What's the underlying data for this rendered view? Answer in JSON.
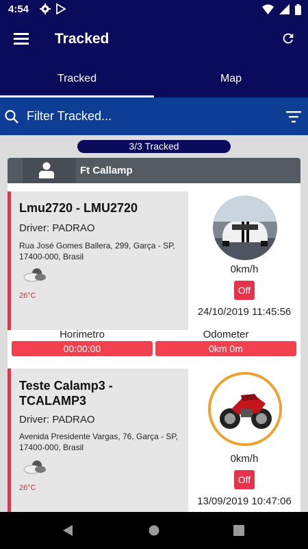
{
  "status_bar": {
    "time": "4:54",
    "icons": [
      "gear-icon",
      "play-store-icon",
      "wifi-icon",
      "signal-icon",
      "battery-icon"
    ]
  },
  "app_bar": {
    "title": "Tracked",
    "menu_icon": "menu-icon",
    "refresh_icon": "refresh-icon"
  },
  "tabs": [
    {
      "label": "Tracked",
      "active": true
    },
    {
      "label": "Map",
      "active": false
    }
  ],
  "filter": {
    "placeholder": "Filter Tracked...",
    "search_icon": "search-icon",
    "filter_icon": "filter-list-icon"
  },
  "count_label": "3/3 Tracked",
  "group": {
    "name": "Ft Callamp",
    "avatar_icon": "person-icon"
  },
  "vehicles": [
    {
      "name": "Lmu2720 - LMU2720",
      "driver": "Driver: PADRAO",
      "address": "Rua José Gomes Ballera, 299, Garça - SP, 17400-000, Brasil",
      "temperature": "26°C",
      "weather_icon": "cloudy-weather-icon",
      "photo": "car-photo",
      "speed": "0km/h",
      "ignition": "Off",
      "datetime": "24/10/2019 11:45:56",
      "horimetro_label": "Horimetro",
      "horimetro_value": "00:00:00",
      "odometer_label": "Odometer",
      "odometer_value": "0km 0m"
    },
    {
      "name": "Teste Calamp3 - TCALAMP3",
      "driver": "Driver: PADRAO",
      "address": "Avenida Presidente Vargas, 76, Garça - SP, 17400-000, Brasil",
      "temperature": "26°C",
      "weather_icon": "cloudy-weather-icon",
      "photo": "motorcycle-photo",
      "speed": "0km/h",
      "ignition": "Off",
      "datetime": "13/09/2019 10:47:06"
    }
  ],
  "nav": [
    "back-icon",
    "home-icon",
    "recents-icon"
  ],
  "colors": {
    "primary": "#0b0b5c",
    "filter_bar": "#0d3d95",
    "accent_red": "#e5334b",
    "group_header": "#535a62"
  }
}
